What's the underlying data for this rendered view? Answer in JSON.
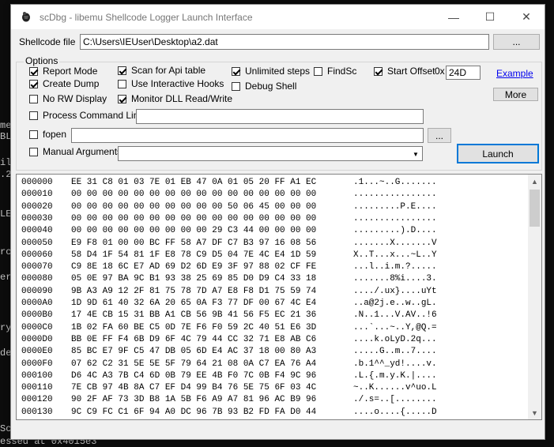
{
  "console_fragments": [
    "mer",
    "BL",
    "il",
    ".2",
    "LE",
    "rc",
    "er",
    "ry",
    "de",
    "Sc",
    "essed at 0x4015e3"
  ],
  "window": {
    "title": "scDbg  -  libemu Shellcode Logger Launch Interface",
    "controls": {
      "minimize": "—",
      "maximize": "☐",
      "close": "✕"
    }
  },
  "shellcode": {
    "label": "Shellcode file",
    "value": "C:\\Users\\IEUser\\Desktop\\a2.dat",
    "browse_label": "..."
  },
  "options": {
    "title": "Options",
    "report_mode": {
      "label": "Report Mode",
      "checked": true
    },
    "create_dump": {
      "label": "Create Dump",
      "checked": true
    },
    "no_rw_display": {
      "label": "No RW Display",
      "checked": false
    },
    "scan_for_api_table": {
      "label": "Scan for Api table",
      "checked": true
    },
    "use_interactive_hooks": {
      "label": "Use Interactive Hooks",
      "checked": false
    },
    "monitor_dll_rw": {
      "label": "Monitor DLL Read/Write",
      "checked": true
    },
    "unlimited_steps": {
      "label": "Unlimited steps",
      "checked": true
    },
    "debug_shell": {
      "label": "Debug Shell",
      "checked": false
    },
    "findsc": {
      "label": "FindSc",
      "checked": false
    },
    "start_offset": {
      "label": "Start Offset",
      "checked": true,
      "prefix": "0x",
      "value": "24D"
    },
    "example_link": "Example",
    "more_button": "More",
    "process_command_line": {
      "label": "Process Command Line",
      "checked": false,
      "value": ""
    },
    "fopen": {
      "label": "fopen",
      "checked": false,
      "value": "",
      "browse_label": "..."
    },
    "manual_arguments": {
      "label": "Manual  Arguments",
      "checked": false,
      "value": ""
    },
    "launch_button": "Launch"
  },
  "hex_dump": [
    {
      "offset": "000000",
      "bytes": "EE 31 C8 01 03 7E 01 EB 47 0A 01 05 20 FF A1 EC",
      "ascii": ".1...~..G......."
    },
    {
      "offset": "000010",
      "bytes": "00 00 00 00 00 00 00 00 00 00 00 00 00 00 00 00",
      "ascii": "................"
    },
    {
      "offset": "000020",
      "bytes": "00 00 00 00 00 00 00 00 00 00 50 06 45 00 00 00",
      "ascii": ".........P.E...."
    },
    {
      "offset": "000030",
      "bytes": "00 00 00 00 00 00 00 00 00 00 00 00 00 00 00 00",
      "ascii": "................"
    },
    {
      "offset": "000040",
      "bytes": "00 00 00 00 00 00 00 00 00 29 C3 44 00 00 00 00",
      "ascii": ".........).D...."
    },
    {
      "offset": "000050",
      "bytes": "E9 F8 01 00 00 BC FF 58 A7 DF C7 B3 97 16 08 56",
      "ascii": ".......X.......V"
    },
    {
      "offset": "000060",
      "bytes": "58 D4 1F 54 81 1F E8 78 C9 D5 04 7E 4C E4 1D 59",
      "ascii": "X..T...x...~L..Y"
    },
    {
      "offset": "000070",
      "bytes": "C9 8E 18 6C E7 AD 69 D2 6D E9 3F 97 88 02 CF FE",
      "ascii": "...l..i.m.?....."
    },
    {
      "offset": "000080",
      "bytes": "05 0E 97 BA 9C B1 93 38 25 69 85 D0 D9 C4 33 18",
      "ascii": ".......8%i....3."
    },
    {
      "offset": "000090",
      "bytes": "9B A3 A9 12 2F 81 75 78 7D A7 E8 F8 D1 75 59 74",
      "ascii": "..../.ux}....uYt"
    },
    {
      "offset": "0000A0",
      "bytes": "1D 9D 61 40 32 6A 20 65 0A F3 77 DF 00 67 4C E4",
      "ascii": "..a@2j.e..w..gL."
    },
    {
      "offset": "0000B0",
      "bytes": "17 4E CB 15 31 BB A1 CB 56 9B 41 56 F5 EC 21 36",
      "ascii": ".N..1...V.AV..!6"
    },
    {
      "offset": "0000C0",
      "bytes": "1B 02 FA 60 BE C5 0D 7E F6 F0 59 2C 40 51 E6 3D",
      "ascii": "...`...~..Y,@Q.="
    },
    {
      "offset": "0000D0",
      "bytes": "BB 0E FF F4 6B D9 6F 4C 79 44 CC 32 71 E8 AB C6",
      "ascii": "....k.oLyD.2q..."
    },
    {
      "offset": "0000E0",
      "bytes": "85 BC E7 9F C5 47 DB 05 6D E4 AC 37 18 00 80 A3",
      "ascii": ".....G..m..7...."
    },
    {
      "offset": "0000F0",
      "bytes": "07 62 C2 31 5E 5E 5F 79 64 21 08 0A C7 EA 76 A4",
      "ascii": ".b.1^^_yd!....v."
    },
    {
      "offset": "000100",
      "bytes": "D6 4C A3 7B C4 6D 0B 79 EE 4B F0 7C 0B F4 9C 96",
      "ascii": ".L.{.m.y.K.|...."
    },
    {
      "offset": "000110",
      "bytes": "7E CB 97 4B 8A C7 EF D4 99 B4 76 5E 75 6F 03 4C",
      "ascii": "~..K......v^uo.L"
    },
    {
      "offset": "000120",
      "bytes": "90 2F AF 73 3D B8 1A 5B F6 A9 A7 81 96 AC B9 96",
      "ascii": "./.s=..[........"
    },
    {
      "offset": "000130",
      "bytes": "9C C9 FC C1 6F 94 A0 DC 96 7B 93 B2 FD FA D0 44",
      "ascii": "....o....{.....D"
    }
  ]
}
